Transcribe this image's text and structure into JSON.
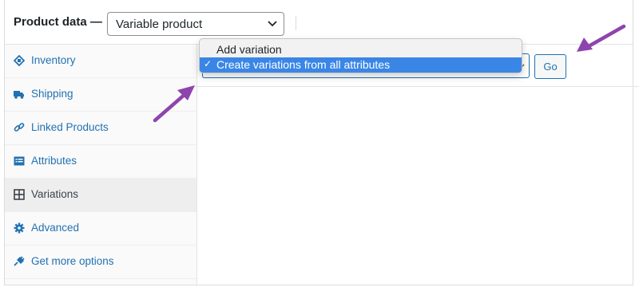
{
  "header": {
    "label": "Product data —",
    "product_type": "Variable product"
  },
  "sidebar": {
    "items": [
      {
        "label": "Inventory",
        "icon": "inventory-icon"
      },
      {
        "label": "Shipping",
        "icon": "truck-icon"
      },
      {
        "label": "Linked Products",
        "icon": "link-icon"
      },
      {
        "label": "Attributes",
        "icon": "list-icon"
      },
      {
        "label": "Variations",
        "icon": "grid-icon",
        "active": true
      },
      {
        "label": "Advanced",
        "icon": "gear-icon"
      },
      {
        "label": "Get more options",
        "icon": "plugin-icon"
      }
    ]
  },
  "variations": {
    "dropdown_options": [
      "Add variation",
      "Create variations from all attributes"
    ],
    "selected_option": "Create variations from all attributes",
    "check_mark": "✓",
    "go_label": "Go"
  },
  "colors": {
    "link": "#2271b1",
    "highlight": "#3a86e6",
    "arrow": "#8e44ad"
  }
}
